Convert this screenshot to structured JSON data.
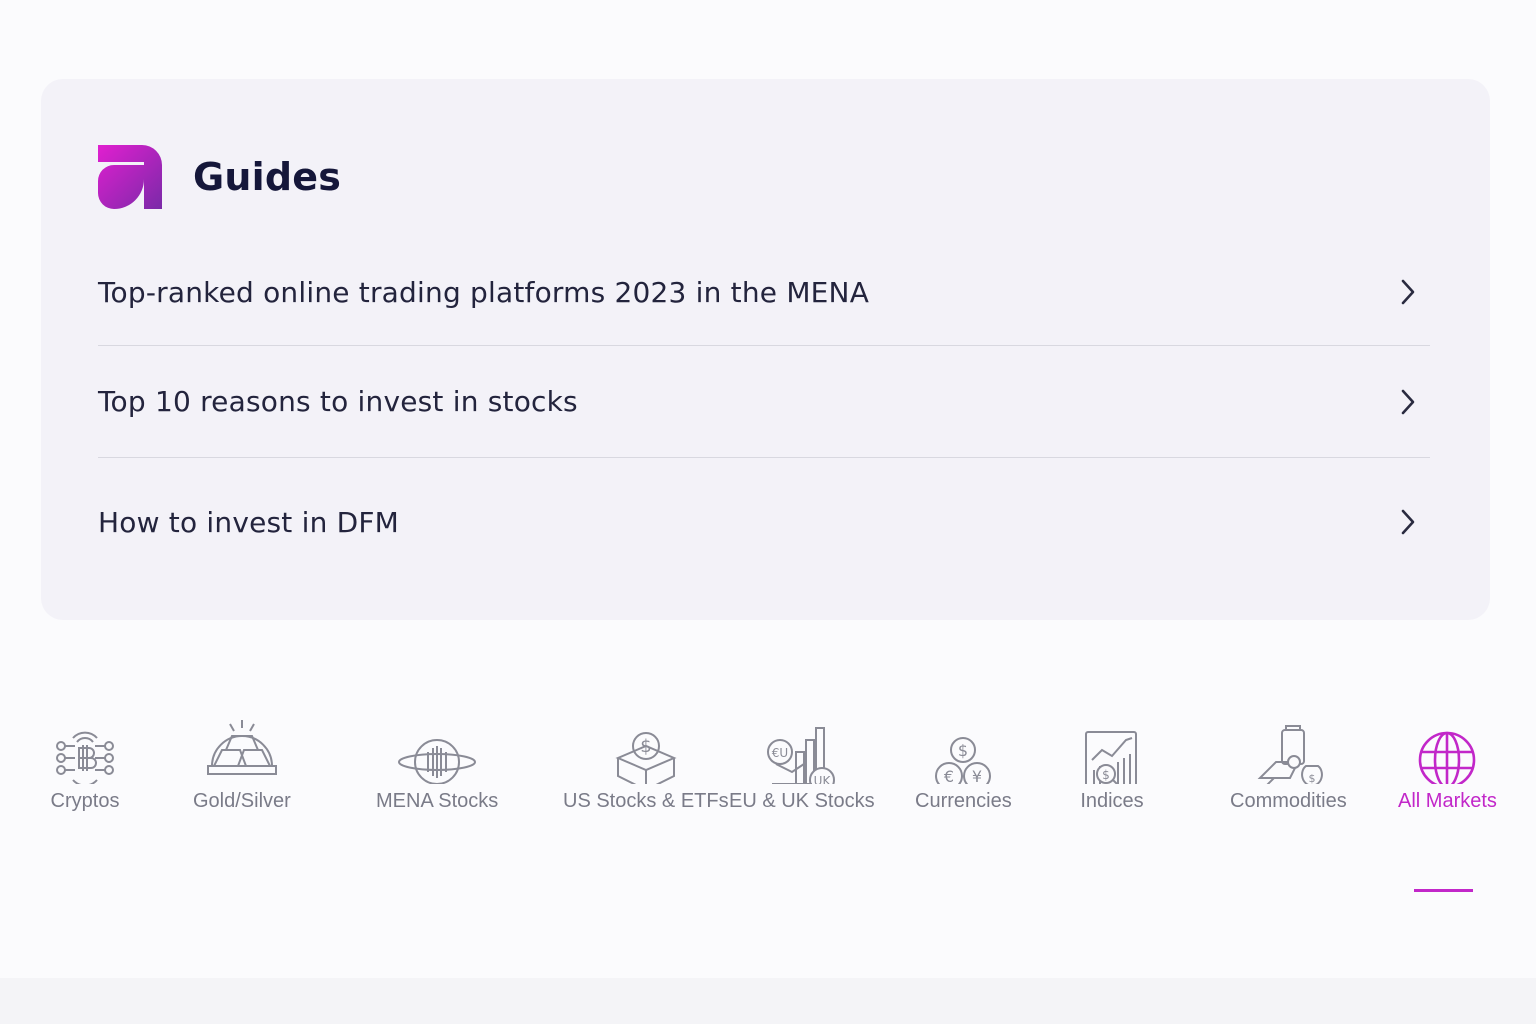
{
  "guides": {
    "title": "Guides",
    "items": [
      {
        "label": "Top-ranked online trading platforms 2023 in the MENA",
        "icon": "chevron-right-icon"
      },
      {
        "label": "Top 10 reasons to invest in stocks",
        "icon": "chevron-right-icon"
      },
      {
        "label": "How to invest in DFM",
        "icon": "chevron-right-icon"
      }
    ]
  },
  "markets": {
    "tabs": [
      {
        "label": "Cryptos",
        "icon": "crypto-icon"
      },
      {
        "label": "Gold/Silver",
        "icon": "gold-bars-icon"
      },
      {
        "label": "MENA Stocks",
        "icon": "mena-stocks-icon"
      },
      {
        "label": "US Stocks & ETFs",
        "icon": "dollar-box-icon"
      },
      {
        "label": "EU & UK Stocks",
        "icon": "eu-uk-chart-icon"
      },
      {
        "label": "Currencies",
        "icon": "currency-coins-icon"
      },
      {
        "label": "Indices",
        "icon": "indices-chart-icon"
      },
      {
        "label": "Commodities",
        "icon": "commodities-icon"
      },
      {
        "label": "All Markets",
        "icon": "globe-icon"
      }
    ],
    "active_tab": "All Markets"
  },
  "colors": {
    "accent": "#c227c9",
    "brand_gradient_start": "#e11fd0",
    "brand_gradient_end": "#7a2aa8",
    "card_background": "#f3f2f8",
    "icon_gray": "#7a7b88"
  }
}
